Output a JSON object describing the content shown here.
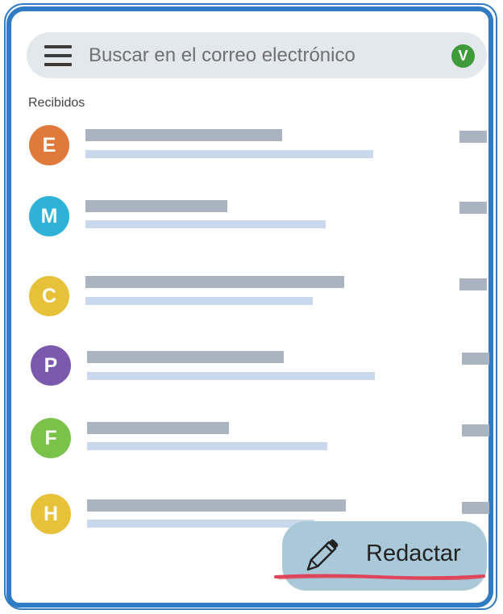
{
  "search": {
    "placeholder": "Buscar en el correo electrónico"
  },
  "account": {
    "initial": "V",
    "color": "#3f9b3a"
  },
  "section": {
    "title": "Recibidos"
  },
  "emails": [
    {
      "initial": "E",
      "color": "#e07a3c"
    },
    {
      "initial": "M",
      "color": "#2fb2d8"
    },
    {
      "initial": "C",
      "color": "#e8c13a"
    },
    {
      "initial": "P",
      "color": "#7b5aad"
    },
    {
      "initial": "F",
      "color": "#7bc24a"
    },
    {
      "initial": "H",
      "color": "#e8c13a"
    }
  ],
  "compose": {
    "label": "Redactar"
  },
  "colors": {
    "frame": "#2f7bc4",
    "accent_underline": "#e0445a"
  }
}
